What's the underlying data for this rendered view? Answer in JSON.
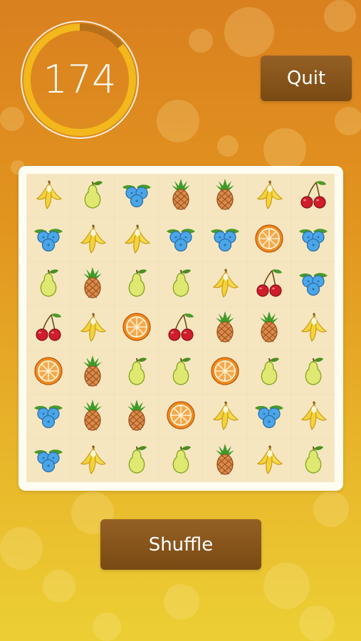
{
  "timer": {
    "value": "174",
    "fraction_remaining": 0.86
  },
  "buttons": {
    "quit_label": "Quit",
    "shuffle_label": "Shuffle"
  },
  "colors": {
    "button": "#85541b",
    "board": "#fffdf2",
    "tile": "#f6e6c0",
    "ring": "#f2b81c"
  },
  "board": {
    "rows": [
      [
        "banana",
        "pear",
        "blueberry",
        "pineapple",
        "pineapple",
        "banana",
        "cherry"
      ],
      [
        "blueberry",
        "banana",
        "banana",
        "blueberry",
        "blueberry",
        "orange",
        "blueberry"
      ],
      [
        "pear",
        "pineapple",
        "pear",
        "pear",
        "banana",
        "cherry",
        "blueberry"
      ],
      [
        "cherry",
        "banana",
        "orange",
        "cherry",
        "pineapple",
        "pineapple",
        "banana"
      ],
      [
        "orange",
        "pineapple",
        "pear",
        "pear",
        "orange",
        "pear",
        "pear"
      ],
      [
        "blueberry",
        "pineapple",
        "pineapple",
        "orange",
        "banana",
        "blueberry",
        "banana"
      ],
      [
        "blueberry",
        "banana",
        "pear",
        "pear",
        "pineapple",
        "banana",
        "pear"
      ]
    ]
  }
}
